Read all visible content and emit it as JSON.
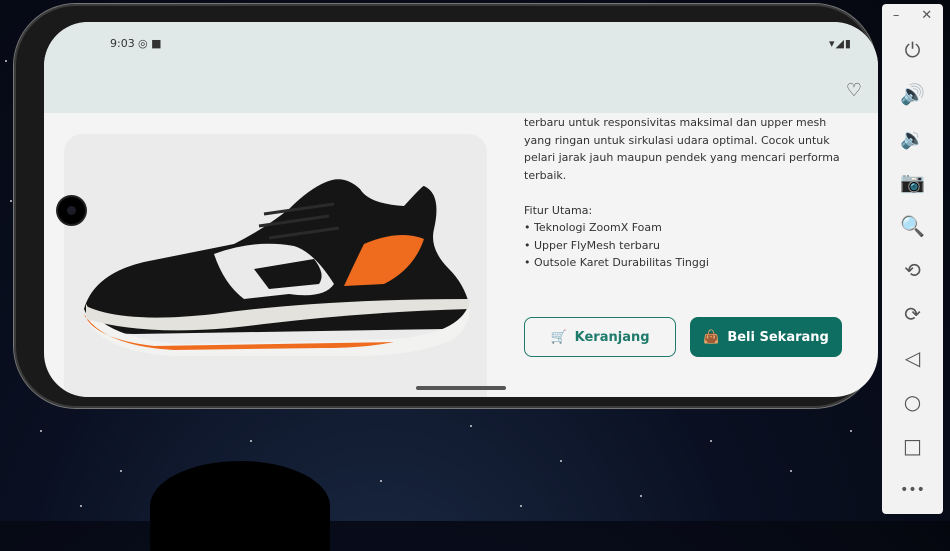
{
  "status_bar": {
    "time": "9:03",
    "left_icons": "◎ ■",
    "right_icons": "▾◢▮"
  },
  "appbar": {
    "favorite_icon": "heart-icon"
  },
  "product": {
    "description": "terbaru untuk responsivitas maksimal dan upper mesh\nyang ringan untuk sirkulasi udara optimal. Cocok untuk\npelari jarak jauh maupun pendek yang mencari performa\nterbaik.\n\nFitur Utama:\n• Teknologi ZoomX Foam\n• Upper FlyMesh terbaru\n• Outsole Karet Durabilitas Tinggi"
  },
  "actions": {
    "cart_label": "Keranjang",
    "buy_label": "Beli Sekarang"
  },
  "colors": {
    "primary": "#0f6e62",
    "appbar": "#e1e9e8",
    "shoe_accent": "#ef6c1f"
  },
  "emulator": {
    "window_minimize": "–",
    "window_close": "✕",
    "more": "•••"
  }
}
